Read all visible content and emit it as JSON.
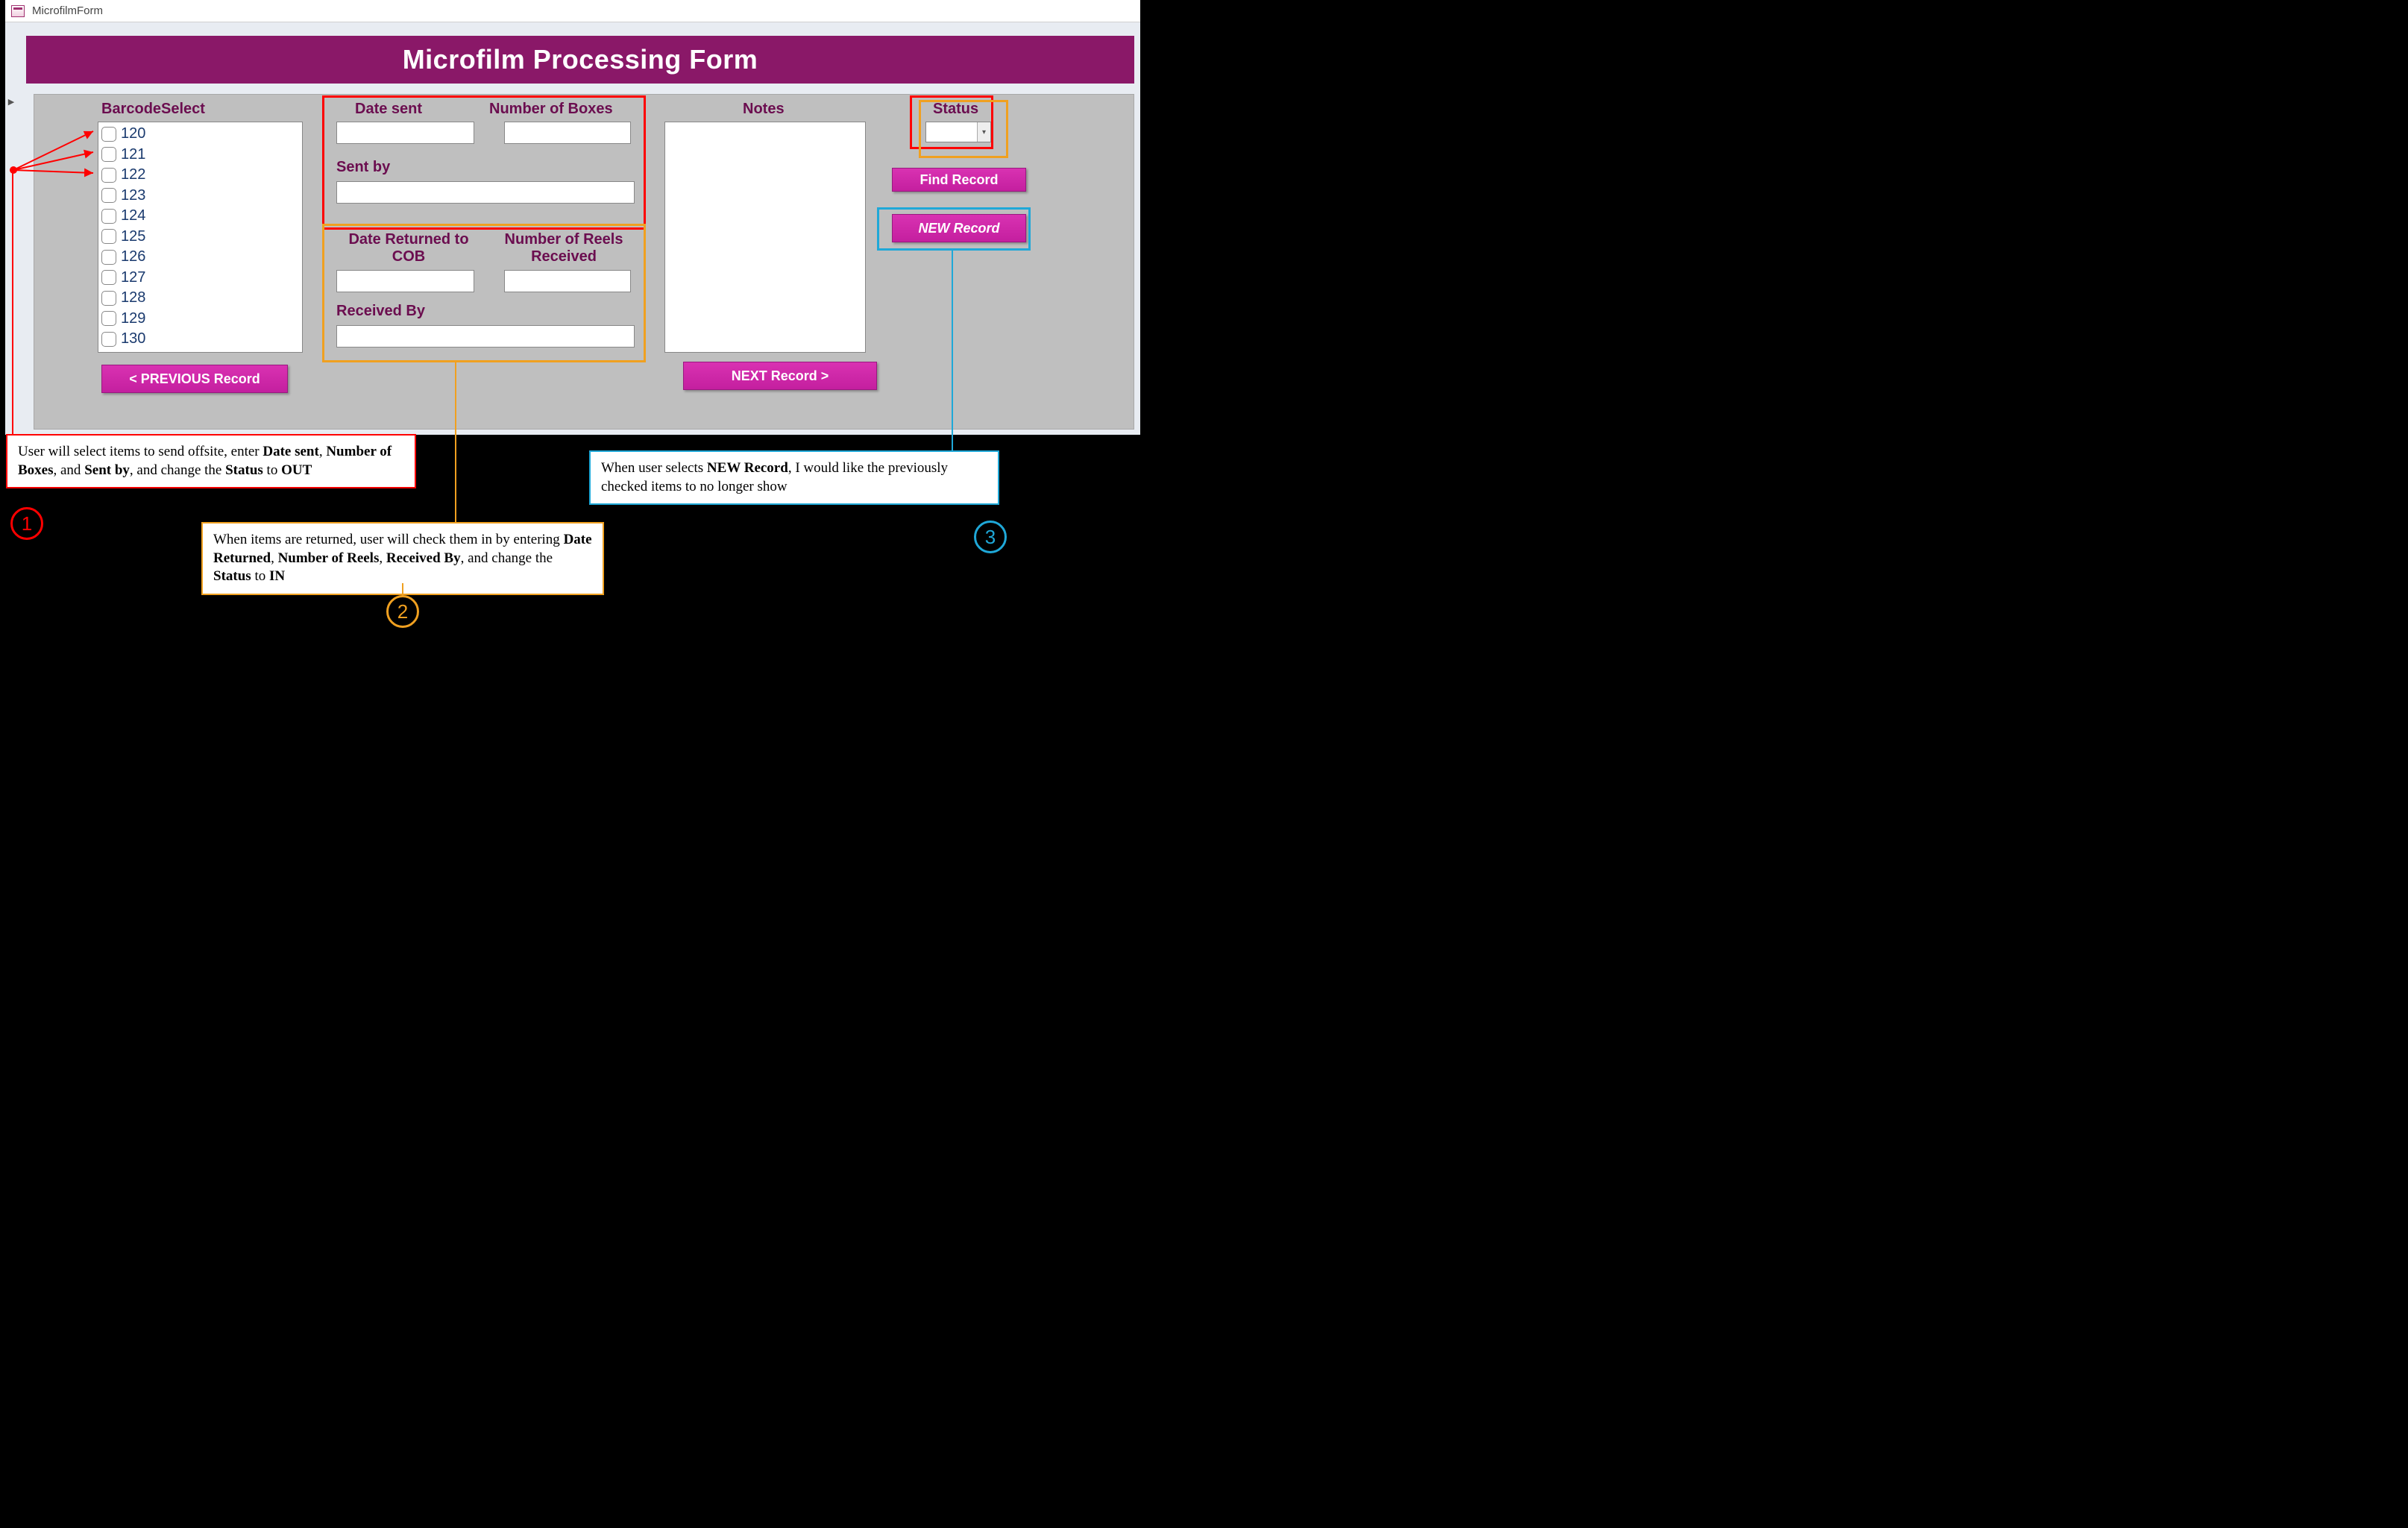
{
  "window": {
    "title": "MicrofilmForm"
  },
  "header": {
    "title": "Microfilm Processing Form"
  },
  "barcode": {
    "label": "BarcodeSelect",
    "items": [
      "120",
      "121",
      "122",
      "123",
      "124",
      "125",
      "126",
      "127",
      "128",
      "129",
      "130"
    ]
  },
  "sent": {
    "date_label": "Date sent",
    "boxes_label": "Number of Boxes",
    "sent_by_label": "Sent by"
  },
  "returned": {
    "date_label": "Date Returned to COB",
    "reels_label": "Number of Reels Received",
    "received_by_label": "Received By"
  },
  "notes": {
    "label": "Notes"
  },
  "status": {
    "label": "Status"
  },
  "buttons": {
    "find": "Find Record",
    "new": "NEW Record",
    "prev": "<   PREVIOUS Record",
    "next": "NEXT Record   >"
  },
  "annotations": {
    "c1_pre": "User will select items to send offsite, enter ",
    "c1_b1": "Date sent",
    "c1_m1": ", ",
    "c1_b2": "Number of Boxes",
    "c1_m2": ", and ",
    "c1_b3": "Sent by",
    "c1_m3": ", and change the ",
    "c1_b4": "Status",
    "c1_m4": " to ",
    "c1_b5": "OUT",
    "c2_pre": "When items are returned, user will check them in by entering ",
    "c2_b1": "Date Returned",
    "c2_m1": ", ",
    "c2_b2": "Number of Reels",
    "c2_m2": ", ",
    "c2_b3": "Received By",
    "c2_m3": ", and change the ",
    "c2_b4": "Status",
    "c2_m4": " to ",
    "c2_b5": "IN",
    "c3_pre": "When user selects ",
    "c3_b1": "NEW Record",
    "c3_post": ", I would like the previously checked items to no longer show",
    "n1": "1",
    "n2": "2",
    "n3": "3"
  }
}
